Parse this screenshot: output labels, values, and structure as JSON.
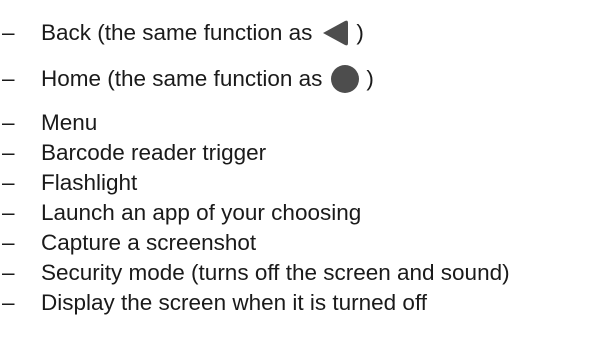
{
  "items": [
    {
      "dash": "–",
      "text": "Back (the same function as ",
      "icon": "back-triangle-icon",
      "suffix": ")"
    },
    {
      "dash": "–",
      "text": "Home (the same function as ",
      "icon": "home-circle-icon",
      "suffix": ")"
    },
    {
      "dash": "–",
      "text": "Menu"
    },
    {
      "dash": "–",
      "text": "Barcode reader trigger"
    },
    {
      "dash": "–",
      "text": "Flashlight"
    },
    {
      "dash": "–",
      "text": "Launch an app of your choosing"
    },
    {
      "dash": "–",
      "text": "Capture a screenshot"
    },
    {
      "dash": "–",
      "text": "Security mode (turns off the screen and sound)"
    },
    {
      "dash": "–",
      "text": "Display the screen when it is turned off"
    }
  ],
  "colors": {
    "text": "#1a1a1a",
    "icon_fill": "#4d4d4d"
  }
}
